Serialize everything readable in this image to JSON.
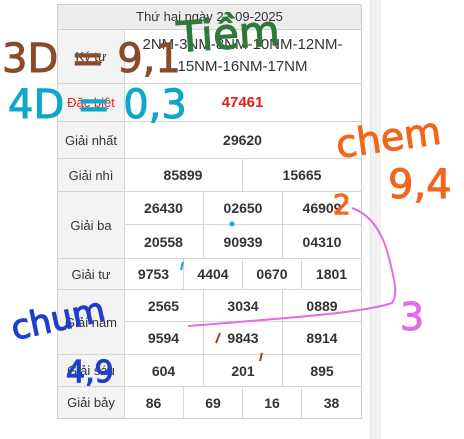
{
  "header": {
    "date": "Thứ hai ngày 22-09-2025"
  },
  "rows": {
    "ky_tu": {
      "label": "Ký tự",
      "value": "2NM-3NM-8NM-10NM-12NM-15NM-16NM-17NM"
    },
    "dac_biet": {
      "label": "Đặc biệt",
      "values": [
        "47461"
      ]
    },
    "giai_nhat": {
      "label": "Giải nhất",
      "values": [
        "29620"
      ]
    },
    "giai_nhi": {
      "label": "Giải nhì",
      "values": [
        "85899",
        "15665"
      ]
    },
    "giai_ba": {
      "label": "Giải ba",
      "values": [
        "26430",
        "02650",
        "46909",
        "20558",
        "90939",
        "04310"
      ]
    },
    "giai_tu": {
      "label": "Giải tư",
      "values": [
        "9753",
        "4404",
        "0670",
        "1801"
      ]
    },
    "giai_nam": {
      "label": "Giải năm",
      "values": [
        "2565",
        "3034",
        "0889",
        "9594",
        "9843",
        "8914"
      ]
    },
    "giai_sau": {
      "label": "Giải sáu",
      "values": [
        "604",
        "201",
        "895"
      ]
    },
    "giai_bay": {
      "label": "Giải bảy",
      "values": [
        "86",
        "69",
        "16",
        "38"
      ]
    }
  },
  "annotations": {
    "note_3d": "3D = 9,1",
    "note_4d": "4D = 0,3",
    "note_tiem": "Tiềm",
    "note_chem": "chem",
    "note_chem_value": "9,4",
    "note_2": "2",
    "note_3": "3",
    "note_chum": "chum",
    "note_chum_value": "4,9",
    "ink_colors": {
      "brown": "#8a4b2b",
      "cyan": "#11a6c9",
      "green": "#2f7a3a",
      "orange": "#f2661b",
      "pink": "#e56be8",
      "blue": "#1d3fc9"
    }
  }
}
